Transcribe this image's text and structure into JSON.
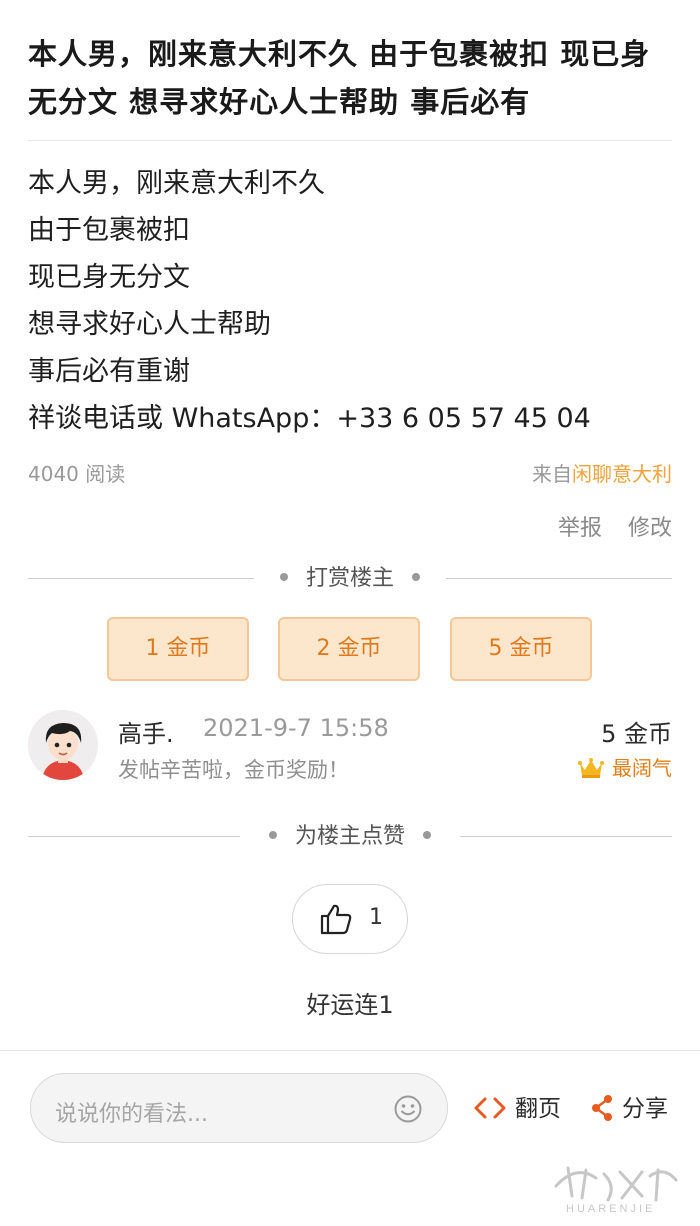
{
  "post": {
    "title": "本人男，刚来意大利不久 由于包裹被扣 现已身无分文 想寻求好心人士帮助 事后必有",
    "body_lines": [
      "本人男，刚来意大利不久",
      "由于包裹被扣",
      "现已身无分文",
      "想寻求好心人士帮助",
      "事后必有重谢",
      "祥谈电话或 WhatsApp：+33 6 05 57 45 04"
    ],
    "reads": "4040 阅读",
    "source_prefix": "来自",
    "source_forum": "闲聊意大利"
  },
  "actions": {
    "report": "举报",
    "edit": "修改"
  },
  "tip_section": {
    "label": "打赏楼主",
    "options": [
      "1 金币",
      "2 金币",
      "5 金币"
    ]
  },
  "reward": {
    "user": "高手.",
    "time": "2021-9-7 15:58",
    "message": "发帖辛苦啦，金币奖励！",
    "amount": "5 金币",
    "badge": "最阔气"
  },
  "like_section": {
    "label": "为楼主点赞",
    "count": "1",
    "liker": "好运连1"
  },
  "bottom_bar": {
    "comment_placeholder": "说说你的看法...",
    "page_turn": "翻页",
    "share": "分享"
  },
  "colors": {
    "accent": "#f0a23c",
    "coin_bg": "#fde7cc",
    "coin_text": "#e0791c",
    "icon_orange": "#e85a1f"
  },
  "icons": [
    "thumbs-up-icon",
    "emoji-icon",
    "code-arrows-icon",
    "share-icon",
    "crown-icon"
  ],
  "watermark": "HUARENJIE"
}
